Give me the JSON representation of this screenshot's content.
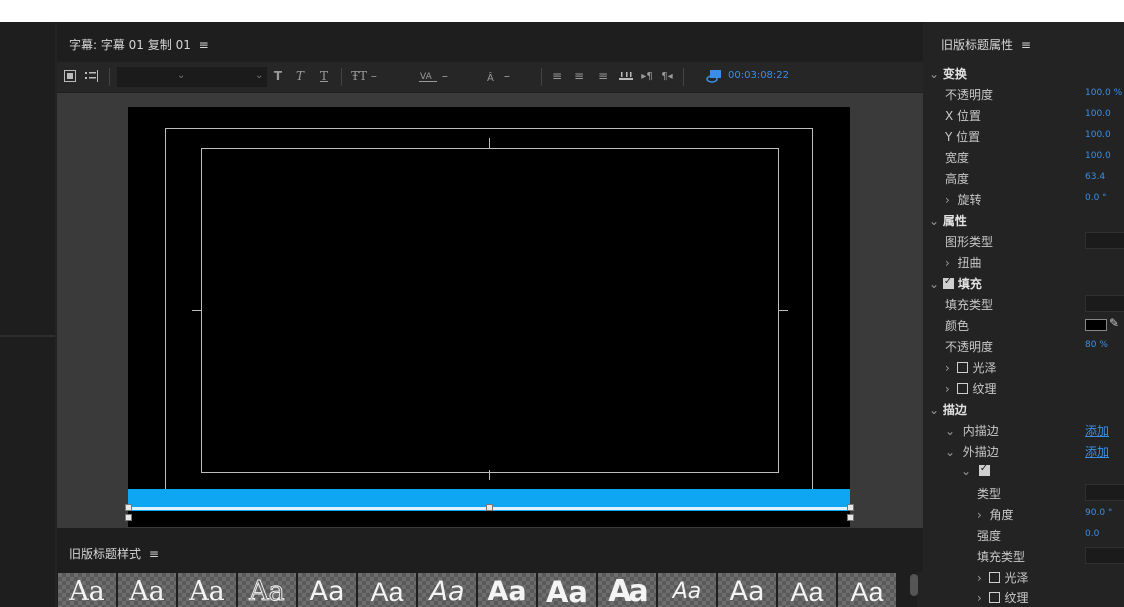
{
  "title_panel": {
    "title": "字幕: 字幕 01 复制 01",
    "menu_icon": "≡",
    "toolbar": {
      "timecode": "00:03:08:22",
      "tool_icons": [
        "film-icon",
        "list-icon"
      ],
      "text_icons": [
        "T",
        "T",
        "T",
        "T",
        "–",
        "–",
        "–"
      ]
    }
  },
  "styles_panel": {
    "title": "旧版标题样式",
    "menu_icon": "≡",
    "swatches": [
      "Aa",
      "Aa",
      "Aa",
      "Aa",
      "Aa",
      "Aa",
      "Aa",
      "Aa",
      "Aa",
      "Aa",
      "Aa",
      "Aa",
      "Aa",
      "Aa"
    ]
  },
  "props_panel": {
    "title": "旧版标题属性",
    "menu_icon": "≡",
    "transform": {
      "section": "变换",
      "opacity_label": "不透明度",
      "opacity_value": "100.0 %",
      "x_label": "X 位置",
      "x_value": "100.0",
      "y_label": "Y 位置",
      "y_value": "100.0",
      "width_label": "宽度",
      "width_value": "100.0",
      "height_label": "高度",
      "height_value": "63.4",
      "rotation_label": "旋转",
      "rotation_value": "0.0 °"
    },
    "attributes": {
      "section": "属性",
      "graphic_type_label": "图形类型",
      "distort_label": "扭曲"
    },
    "fill": {
      "section": "填充",
      "fill_type_label": "填充类型",
      "color_label": "颜色",
      "color_value": "#000000",
      "opacity_label": "不透明度",
      "opacity_value": "80 %",
      "sheen_label": "光泽",
      "texture_label": "纹理"
    },
    "stroke": {
      "section": "描边",
      "inner_label": "内描边",
      "inner_add": "添加",
      "outer_label": "外描边",
      "outer_add": "添加",
      "type_label": "类型",
      "angle_label": "角度",
      "angle_value": "90.0 °",
      "strength_label": "强度",
      "strength_value": "0.0",
      "fill_type_label": "填充类型",
      "sheen_label": "光泽",
      "texture_label": "纹理"
    }
  },
  "colors": {
    "accent": "#3b8ee8",
    "selection": "#0ea5f2"
  }
}
